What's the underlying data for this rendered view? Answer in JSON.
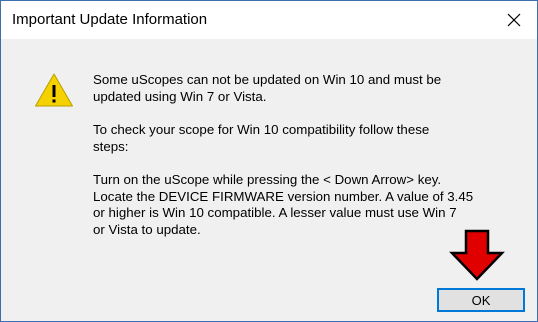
{
  "window": {
    "title": "Important Update Information",
    "close_glyph": "✕"
  },
  "icon": {
    "name": "warning-icon",
    "glyph": "!",
    "color": "#f5d100"
  },
  "message": {
    "paragraph1": "Some uScopes can not be updated on Win 10 and must be\nupdated using Win 7 or Vista.",
    "paragraph2": "To check your scope for Win 10 compatibility follow these\nsteps:",
    "paragraph3": "Turn on the uScope while pressing the < Down Arrow> key.\nLocate the DEVICE FIRMWARE version number. A value of 3.45\nor higher is Win 10 compatible. A lesser value must use Win 7\nor Vista to update."
  },
  "annotation": {
    "name": "red-down-arrow",
    "color": "#e00000"
  },
  "buttons": {
    "ok_label": "OK"
  },
  "colors": {
    "focus_border": "#0078d7",
    "window_border": "#3d6fb0"
  }
}
